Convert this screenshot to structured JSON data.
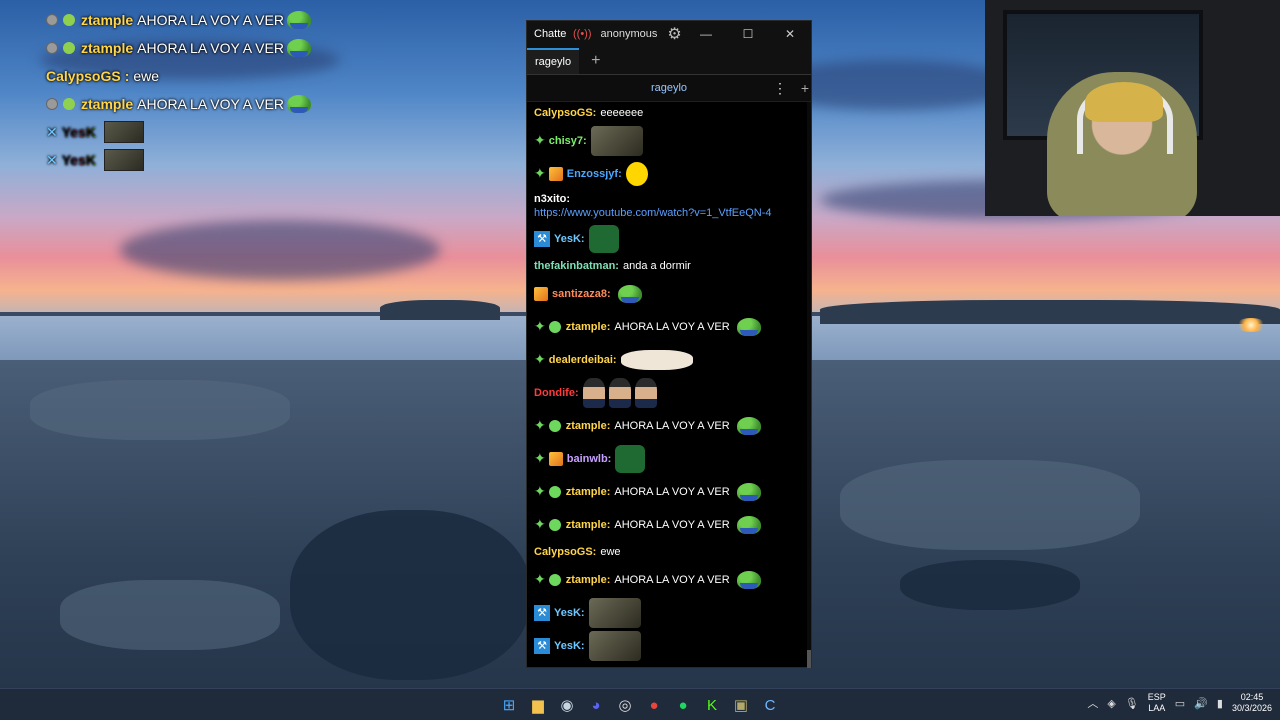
{
  "desktop_chat": [
    {
      "user": "ztample",
      "user_color": "#ffd54a",
      "text": "AHORA LA VOY A VER",
      "badges": [
        "badge-gray",
        "badge-green"
      ],
      "emote": "pepe"
    },
    {
      "user": "ztample",
      "user_color": "#ffd54a",
      "text": "AHORA LA VOY A VER",
      "badges": [
        "badge-gray",
        "badge-green"
      ],
      "emote": "pepe"
    },
    {
      "user": "CalypsoGS",
      "user_color": "#ffd54a",
      "text": "ewe",
      "badges": [],
      "emote": ""
    },
    {
      "user": "ztample",
      "user_color": "#ffd54a",
      "text": "AHORA LA VOY A VER",
      "badges": [
        "badge-gray",
        "badge-green"
      ],
      "emote": "pepe"
    },
    {
      "user": "YesK",
      "user_color": "rainbow",
      "text": "",
      "badges": [
        "hammer"
      ],
      "emote": "photo"
    },
    {
      "user": "YesK",
      "user_color": "rainbow",
      "text": "",
      "badges": [
        "hammer"
      ],
      "emote": "photo"
    }
  ],
  "window": {
    "app_name": "Chatterino",
    "account": "anonymous",
    "tabs": [
      {
        "label": "rageylo"
      }
    ],
    "channel": "rageylo",
    "controls": {
      "minimize": "—",
      "maximize": "☐",
      "close": "✕"
    }
  },
  "messages": [
    {
      "user": "CalypsoGS:",
      "color": "#ffd54a",
      "text": "eeeeeee",
      "badges": [],
      "emote": "",
      "size": "short"
    },
    {
      "user": "chisy7:",
      "color": "#7cf06a",
      "text": "",
      "badges": [
        "prime"
      ],
      "emote": "photo",
      "size": "tall"
    },
    {
      "user": "Enzossjyf:",
      "color": "#4aa8ff",
      "text": "",
      "badges": [
        "prime",
        "box"
      ],
      "emote": "yellow",
      "size": "tall"
    },
    {
      "user": "n3xito:",
      "color": "#ffffff",
      "text": "https://www.youtube.com/watch?v=1_VtfEeQN-4",
      "badges": [],
      "emote": "",
      "size": "link"
    },
    {
      "user": "YesK:",
      "color": "#6ec8ff",
      "text": "",
      "badges": [
        "hammer"
      ],
      "emote": "chunky",
      "size": "tall"
    },
    {
      "user": "thefakinbatman:",
      "color": "#7fe0b8",
      "text": "anda a dormir",
      "badges": [],
      "emote": "",
      "size": "short"
    },
    {
      "user": "santizaza8:",
      "color": "#ff8a5a",
      "text": "",
      "badges": [
        "box"
      ],
      "emote": "pepe",
      "size": "tall"
    },
    {
      "user": "ztample:",
      "color": "#ffd54a",
      "text": "AHORA LA VOY A VER",
      "badges": [
        "prime",
        "green"
      ],
      "emote": "pepe",
      "size": "tall"
    },
    {
      "user": "dealerdeibai:",
      "color": "#ffd54a",
      "text": "",
      "badges": [
        "prime"
      ],
      "emote": "cat",
      "size": "tall"
    },
    {
      "user": "Dondife:",
      "color": "#ff3b3b",
      "text": "",
      "badges": [],
      "emote": "men",
      "size": "tall"
    },
    {
      "user": "ztample:",
      "color": "#ffd54a",
      "text": "AHORA LA VOY A VER",
      "badges": [
        "prime",
        "green"
      ],
      "emote": "pepe",
      "size": "tall"
    },
    {
      "user": "bainwlb:",
      "color": "#c9a0ff",
      "text": "",
      "badges": [
        "prime",
        "box"
      ],
      "emote": "chunky",
      "size": "tall"
    },
    {
      "user": "ztample:",
      "color": "#ffd54a",
      "text": "AHORA LA VOY A VER",
      "badges": [
        "prime",
        "green"
      ],
      "emote": "pepe",
      "size": "tall"
    },
    {
      "user": "ztample:",
      "color": "#ffd54a",
      "text": "AHORA LA VOY A VER",
      "badges": [
        "prime",
        "green"
      ],
      "emote": "pepe",
      "size": "tall"
    },
    {
      "user": "CalypsoGS:",
      "color": "#ffd54a",
      "text": "ewe",
      "badges": [],
      "emote": "",
      "size": "short"
    },
    {
      "user": "ztample:",
      "color": "#ffd54a",
      "text": "AHORA LA VOY A VER",
      "badges": [
        "prime",
        "green"
      ],
      "emote": "pepe",
      "size": "tall"
    },
    {
      "user": "YesK:",
      "color": "#6ec8ff",
      "text": "",
      "badges": [
        "hammer"
      ],
      "emote": "photo",
      "size": "tall"
    },
    {
      "user": "YesK:",
      "color": "#6ec8ff",
      "text": "",
      "badges": [
        "hammer"
      ],
      "emote": "photo",
      "size": "tall"
    }
  ],
  "taskbar": {
    "apps": [
      {
        "name": "windows-start-icon",
        "glyph": "⊞",
        "color": "#4aa8ff"
      },
      {
        "name": "file-explorer-icon",
        "glyph": "▆",
        "color": "#f2c14e"
      },
      {
        "name": "steam-icon",
        "glyph": "◉",
        "color": "#c7d5e0"
      },
      {
        "name": "discord-icon",
        "glyph": "◕",
        "color": "#5865f2"
      },
      {
        "name": "obs-icon",
        "glyph": "◎",
        "color": "#dddddd"
      },
      {
        "name": "chrome-icon",
        "glyph": "●",
        "color": "#e8453c"
      },
      {
        "name": "spotify-icon",
        "glyph": "●",
        "color": "#1ed760"
      },
      {
        "name": "kick-icon",
        "glyph": "K",
        "color": "#53fc18"
      },
      {
        "name": "game-icon",
        "glyph": "▣",
        "color": "#b5a96a"
      },
      {
        "name": "chatterino-icon",
        "glyph": "C",
        "color": "#6fb7ff"
      }
    ],
    "tray": {
      "lang_top": "ESP",
      "lang_bottom": "LAA",
      "time": "02:45",
      "date": "30/3/2026"
    }
  }
}
